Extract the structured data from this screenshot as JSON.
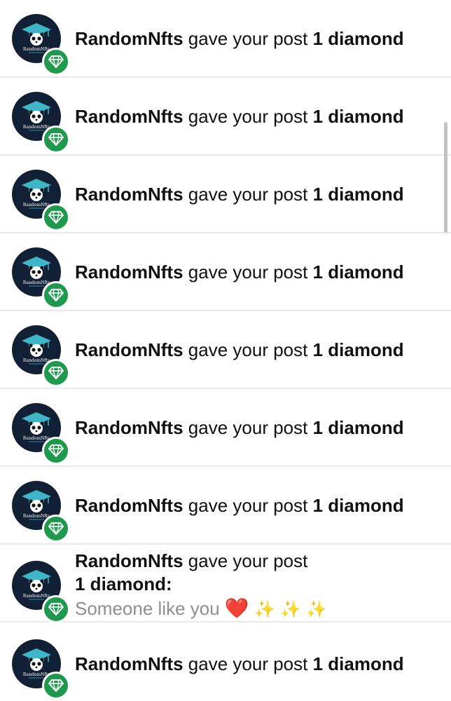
{
  "notifications": [
    {
      "user": "RandomNfts",
      "action": "gave your post",
      "amount": "1 diamond"
    },
    {
      "user": "RandomNfts",
      "action": "gave your post",
      "amount": "1 diamond"
    },
    {
      "user": "RandomNfts",
      "action": "gave your post",
      "amount": "1 diamond"
    },
    {
      "user": "RandomNfts",
      "action": "gave your post",
      "amount": "1 diamond"
    },
    {
      "user": "RandomNfts",
      "action": "gave your post",
      "amount": "1 diamond"
    },
    {
      "user": "RandomNfts",
      "action": "gave your post",
      "amount": "1 diamond"
    },
    {
      "user": "RandomNfts",
      "action": "gave your post",
      "amount": "1 diamond"
    },
    {
      "user": "RandomNfts",
      "action": "gave your post",
      "amount": "1 diamond:",
      "comment": "Someone like you",
      "comment_emojis": [
        "❤️",
        "✨",
        "✨",
        "✨"
      ]
    },
    {
      "user": "RandomNfts",
      "action": "gave your post",
      "amount": "1 diamond"
    }
  ],
  "avatar": {
    "logo_text": "RandomNfts",
    "icon": "graduation-cap-panda-logo"
  },
  "badge": {
    "icon": "diamond-icon"
  },
  "colors": {
    "avatar_bg": "#112034",
    "badge_green": "#1f9a4c",
    "divider": "#e9e9e9",
    "comment_gray": "#8e8e8e"
  }
}
